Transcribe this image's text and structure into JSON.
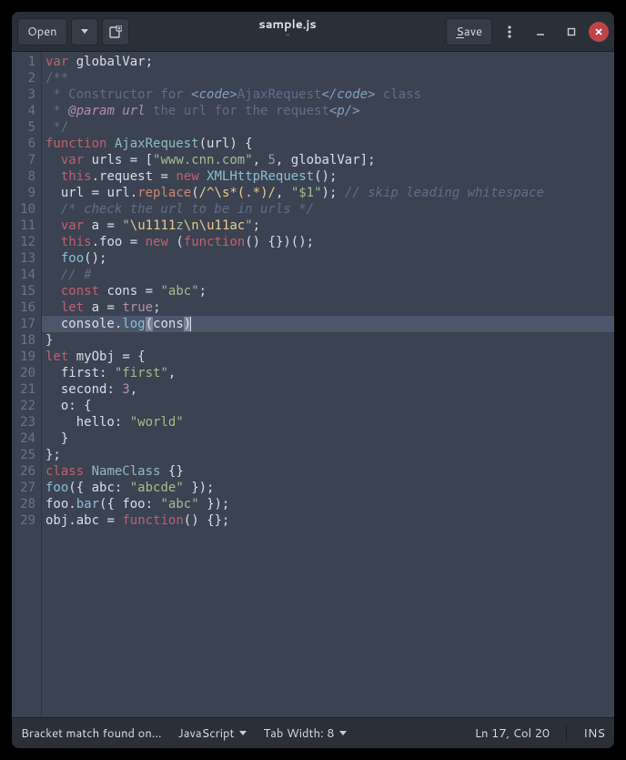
{
  "header": {
    "open_label": "Open",
    "title": "sample.js",
    "subtitle": "~",
    "save_label": "Save"
  },
  "code": {
    "lines": [
      {
        "n": 1,
        "html": "<span class='kw'>var</span> <span class='id'>globalVar</span><span class='punc'>;</span>"
      },
      {
        "n": 2,
        "html": "<span class='cmt-doc'>/**</span>"
      },
      {
        "n": 3,
        "html": "<span class='cmt-doc'> * Constructor for </span><span class='tag'>&lt;code&gt;</span><span class='cmt-doc'>AjaxRequest</span><span class='tag'>&lt;/code&gt;</span><span class='cmt-doc'> class</span>"
      },
      {
        "n": 4,
        "html": "<span class='cmt-doc'> * </span><span class='ann'>@param url</span><span class='cmt-doc'> the url for the request</span><span class='tag'>&lt;p/&gt;</span>"
      },
      {
        "n": 5,
        "html": "<span class='cmt-doc'> */</span>"
      },
      {
        "n": 6,
        "html": "<span class='kw'>function</span> <span class='name'>AjaxRequest</span><span class='punc'>(</span><span class='id'>url</span><span class='punc'>) {</span>"
      },
      {
        "n": 7,
        "html": "  <span class='kw'>var</span> <span class='id'>urls</span> <span class='punc'>= [</span><span class='str'>\"www.cnn.com\"</span><span class='punc'>, </span><span class='num'>5</span><span class='punc'>, </span><span class='id'>globalVar</span><span class='punc'>];</span>"
      },
      {
        "n": 8,
        "html": "  <span class='kw'>this</span><span class='punc'>.</span><span class='id'>request</span> <span class='punc'>=</span> <span class='kw'>new</span> <span class='fn2'>XMLHttpRequest</span><span class='punc'>();</span>"
      },
      {
        "n": 9,
        "html": "  <span class='id'>url</span> <span class='punc'>=</span> <span class='id'>url</span><span class='punc'>.</span><span class='fn'>replace</span><span class='punc'>(</span><span class='re'>/^\\s*(.*)/</span><span class='punc'>, </span><span class='str'>\"$1\"</span><span class='punc'>); </span><span class='cmt'>// skip leading whitespace</span>"
      },
      {
        "n": 10,
        "html": "  <span class='cmt'>/* check the url to be in urls */</span>"
      },
      {
        "n": 11,
        "html": "  <span class='kw'>var</span> <span class='id'>a</span> <span class='punc'>=</span> <span class='str'>\"</span><span class='esc'>\\u1111</span><span class='str'>z</span><span class='esc'>\\n\\u11ac</span><span class='str'>\"</span><span class='punc'>;</span>"
      },
      {
        "n": 12,
        "html": "  <span class='kw'>this</span><span class='punc'>.</span><span class='id'>foo</span> <span class='punc'>=</span> <span class='kw'>new</span> <span class='punc'>(</span><span class='kw'>function</span><span class='punc'>() {})();</span>"
      },
      {
        "n": 13,
        "html": "  <span class='fn2'>foo</span><span class='punc'>();</span>"
      },
      {
        "n": 14,
        "html": "  <span class='cmt'>// #</span>"
      },
      {
        "n": 15,
        "html": "  <span class='kw'>const</span> <span class='id'>cons</span> <span class='punc'>=</span> <span class='str'>\"abc\"</span><span class='punc'>;</span>"
      },
      {
        "n": 16,
        "html": "  <span class='kw'>let</span> <span class='id'>a</span> <span class='punc'>=</span> <span class='bool'>true</span><span class='punc'>;</span>"
      },
      {
        "n": 17,
        "html": "  <span class='id'>console</span><span class='punc'>.</span><span class='fn2'>log</span><span class='punc bracket-hl'>(</span><span class='id'>cons</span><span class='punc bracket-hl'>)</span><span class='cursor'></span>",
        "current": true
      },
      {
        "n": 18,
        "html": "<span class='punc'>}</span>"
      },
      {
        "n": 19,
        "html": "<span class='kw'>let</span> <span class='id'>myObj</span> <span class='punc'>= {</span>"
      },
      {
        "n": 20,
        "html": "  <span class='id'>first</span><span class='punc'>: </span><span class='str'>\"first\"</span><span class='punc'>,</span>"
      },
      {
        "n": 21,
        "html": "  <span class='id'>second</span><span class='punc'>: </span><span class='num'>3</span><span class='punc'>,</span>"
      },
      {
        "n": 22,
        "html": "  <span class='id'>o</span><span class='punc'>: {</span>"
      },
      {
        "n": 23,
        "html": "    <span class='id'>hello</span><span class='punc'>: </span><span class='str'>\"world\"</span>"
      },
      {
        "n": 24,
        "html": "  <span class='punc'>}</span>"
      },
      {
        "n": 25,
        "html": "<span class='punc'>};</span>"
      },
      {
        "n": 26,
        "html": "<span class='kw'>class</span> <span class='name'>NameClass</span> <span class='punc'>{}</span>"
      },
      {
        "n": 27,
        "html": "<span class='fn2'>foo</span><span class='punc'>({ </span><span class='id'>abc</span><span class='punc'>: </span><span class='str'>\"abcde\"</span><span class='punc'> });</span>"
      },
      {
        "n": 28,
        "html": "<span class='id'>foo</span><span class='punc'>.</span><span class='fn2'>bar</span><span class='punc'>({ </span><span class='id'>foo</span><span class='punc'>: </span><span class='str'>\"abc\"</span><span class='punc'> });</span>"
      },
      {
        "n": 29,
        "html": "<span class='id'>obj</span><span class='punc'>.</span><span class='id'>abc</span> <span class='punc'>=</span> <span class='kw'>function</span><span class='punc'>() {};</span>"
      }
    ]
  },
  "statusbar": {
    "message": "Bracket match found on…",
    "language": "JavaScript",
    "tab_width": "Tab Width: 8",
    "position": "Ln 17, Col 20",
    "insert_mode": "INS"
  }
}
